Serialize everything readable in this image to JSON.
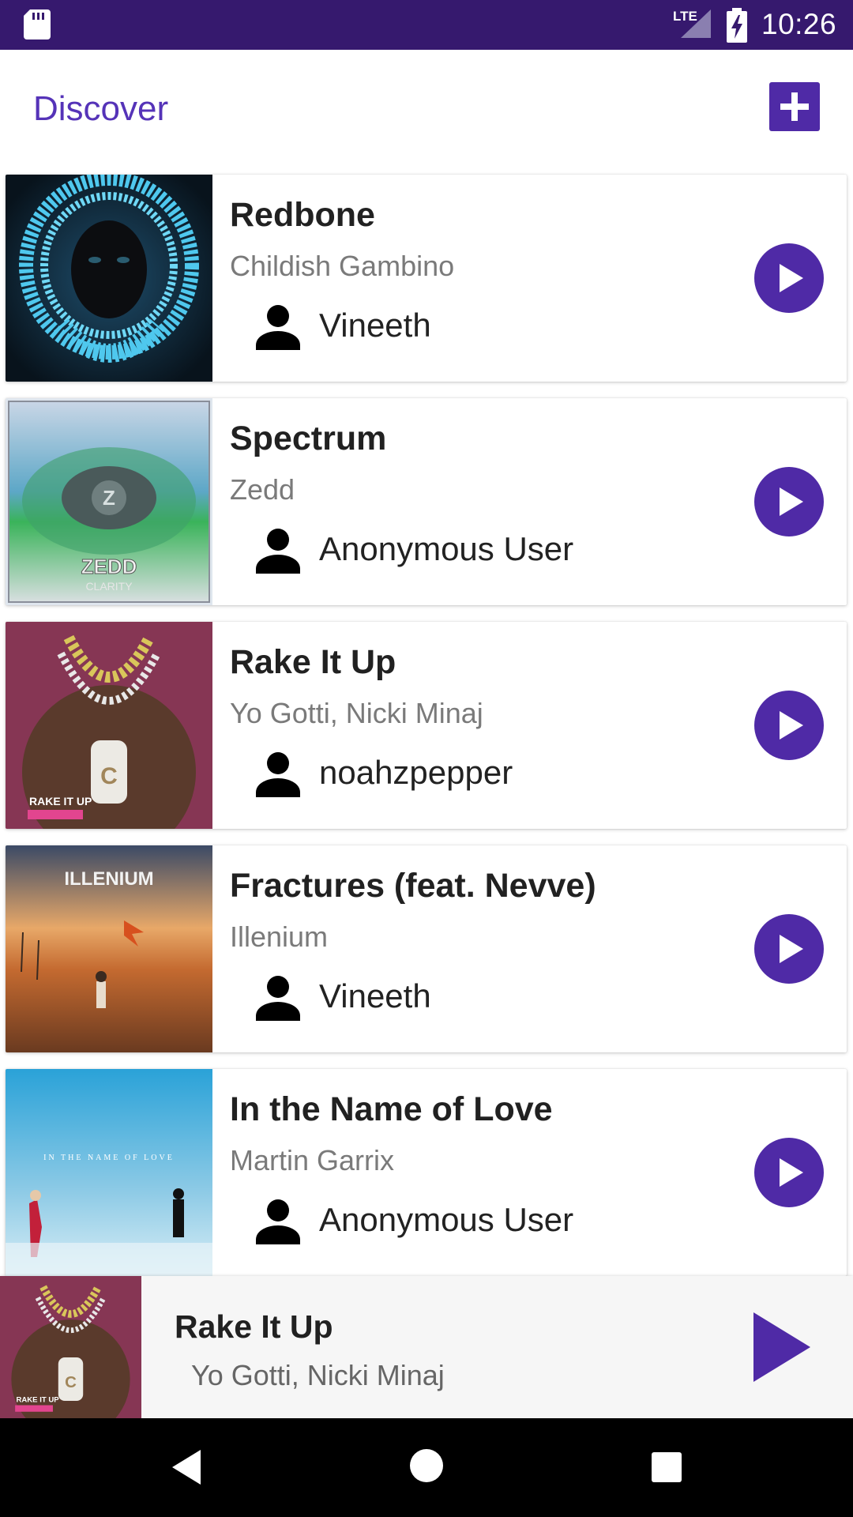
{
  "status_bar": {
    "time": "10:26",
    "network": "LTE",
    "icons": [
      "sd-card-icon",
      "lte-signal-icon",
      "battery-charging-icon"
    ]
  },
  "header": {
    "title": "Discover",
    "add_icon": "plus-icon"
  },
  "songs": [
    {
      "title": "Redbone",
      "artist": "Childish Gambino",
      "user": "Vineeth"
    },
    {
      "title": "Spectrum",
      "artist": "Zedd",
      "user": "Anonymous User"
    },
    {
      "title": "Rake It Up",
      "artist": "Yo Gotti, Nicki Minaj",
      "user": "noahzpepper"
    },
    {
      "title": "Fractures (feat. Nevve)",
      "artist": "Illenium",
      "user": "Vineeth"
    },
    {
      "title": "In the Name of Love",
      "artist": "Martin Garrix",
      "user": "Anonymous User"
    }
  ],
  "now_playing": {
    "title": "Rake It Up",
    "artist": "Yo Gotti, Nicki Minaj"
  },
  "nav_bar": {
    "icons": [
      "back-icon",
      "home-icon",
      "recents-icon"
    ]
  },
  "colors": {
    "status_bar": "#36196e",
    "accent": "#4f2aa6",
    "title": "#5533b8"
  }
}
